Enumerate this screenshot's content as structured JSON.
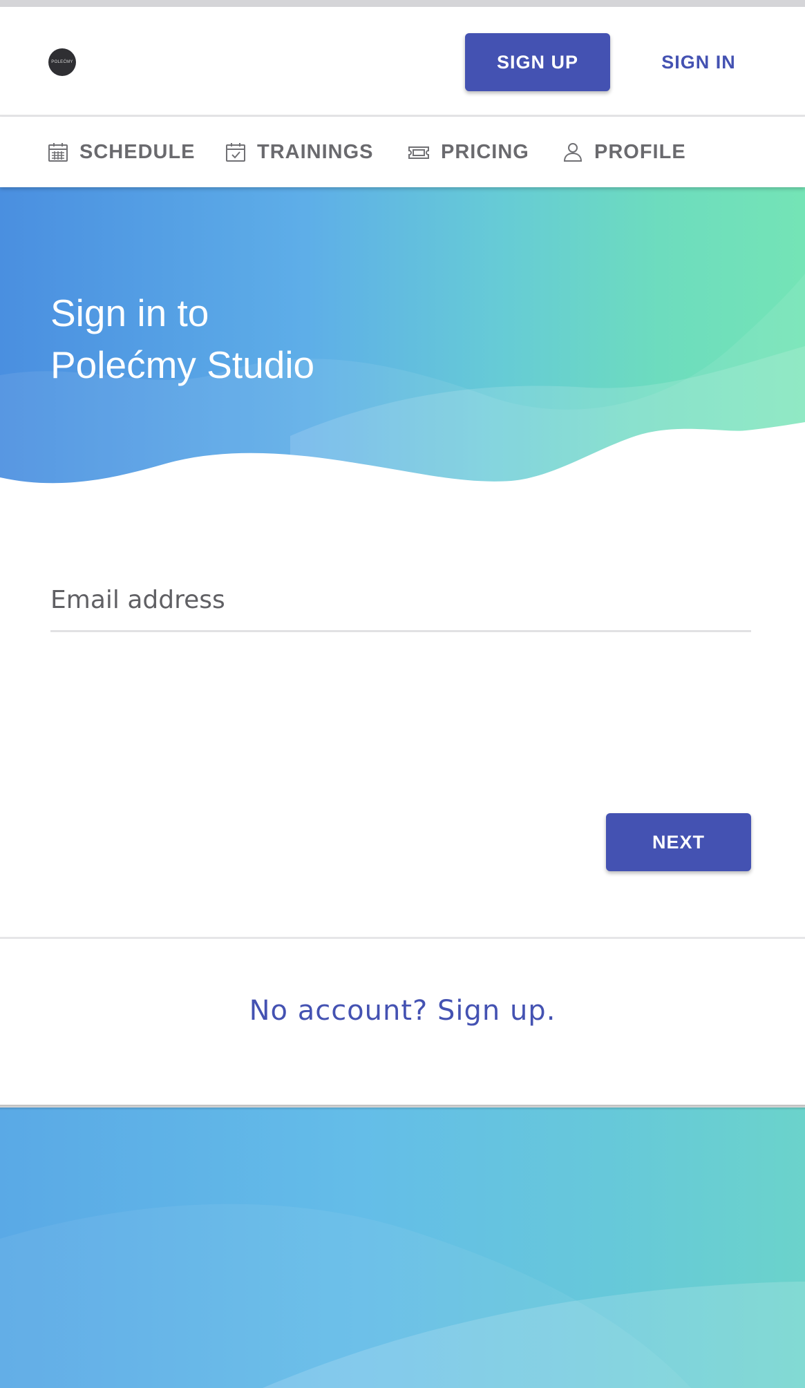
{
  "logo": {
    "text": "POLEĆMY"
  },
  "header": {
    "signup_label": "SIGN UP",
    "signin_label": "SIGN IN"
  },
  "nav": {
    "items": [
      {
        "label": "SCHEDULE",
        "icon": "calendar-grid-icon"
      },
      {
        "label": "TRAININGS",
        "icon": "calendar-check-icon"
      },
      {
        "label": "PRICING",
        "icon": "ticket-icon"
      },
      {
        "label": "PROFILE",
        "icon": "user-icon"
      }
    ]
  },
  "hero": {
    "title_line1": "Sign in to",
    "title_line2": "Polećmy Studio"
  },
  "form": {
    "email_placeholder": "Email address",
    "next_label": "NEXT"
  },
  "footer": {
    "signup_link": "No account? Sign up."
  },
  "colors": {
    "primary": "#4452b2",
    "nav_text": "#6a6a6e",
    "hero_start": "#4a8fe0",
    "hero_end": "#74e4b6"
  }
}
